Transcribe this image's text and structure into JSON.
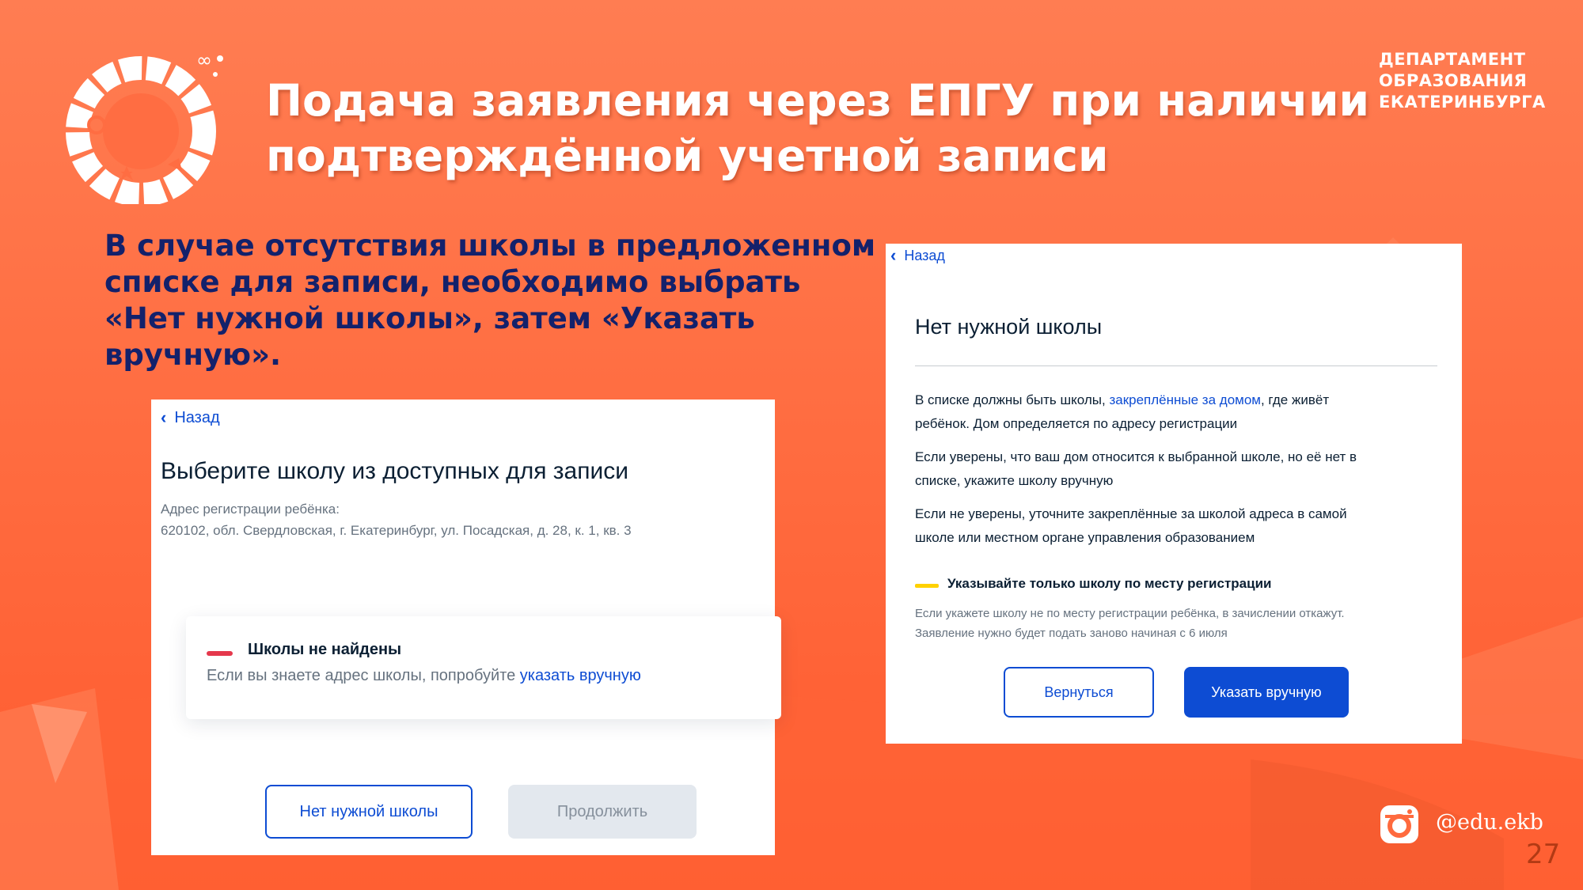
{
  "slide": {
    "title_lines": [
      "Подача заявления через ЕПГУ при наличии",
      "подтверждённой учетной записи"
    ],
    "department_lines": [
      "ДЕПАРТАМЕНТ",
      "ОБРАЗОВАНИЯ",
      "ЕКАТЕРИНБУРГА"
    ],
    "intro_lines": [
      "В случае отсутствия школы в предложенном",
      "списке для записи, необходимо выбрать",
      "«Нет нужной школы», затем «Указать",
      "вручную»."
    ],
    "social_handle": "@edu.ekb",
    "page_number": "27",
    "colors": {
      "background": "#ff6a3e",
      "intro_text": "#13216b",
      "accent_blue": "#0d4cd3"
    }
  },
  "left_screen": {
    "back_label": "Назад",
    "heading": "Выберите школу из доступных для записи",
    "address_label": "Адрес регистрации ребёнка:",
    "address_value": "620102, обл. Свердловская, г. Екатеринбург, ул. Посадская, д. 28, к. 1, кв. 3",
    "notice_title": "Школы не найдены",
    "notice_text": "Если вы знаете адрес школы, попробуйте ",
    "notice_link": "указать вручную",
    "no_school_button": "Нет нужной школы",
    "continue_button": "Продолжить"
  },
  "right_screen": {
    "back_label": "Назад",
    "heading": "Нет нужной школы",
    "para1_line1_start": "В списке должны быть школы, ",
    "para1_link": "закреплённые за домом",
    "para1_line1_end": ", где живёт",
    "para1_line2": "ребёнок. Дом определяется по адресу регистрации",
    "para2_lines": [
      "Если уверены, что ваш дом относится к выбранной школе, но её нет в",
      "списке, укажите школу вручную"
    ],
    "para3_lines": [
      "Если не уверены, уточните закреплённые за школой адреса в самой",
      "школе или местном органе управления образованием"
    ],
    "warning_title": "Указывайте только школу по месту регистрации",
    "warning_lines": [
      "Если укажете школу не по месту регистрации ребёнка, в зачислении откажут.",
      "Заявление нужно будет подать заново начиная с 6 июля"
    ],
    "return_button": "Вернуться",
    "manual_button": "Указать вручную"
  }
}
